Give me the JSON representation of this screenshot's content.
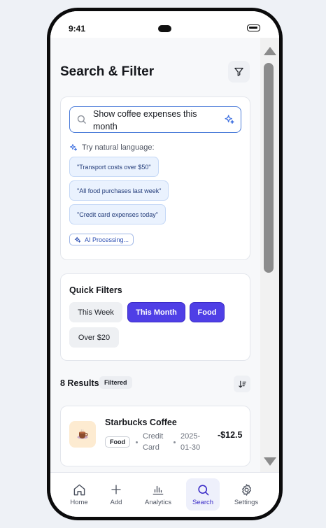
{
  "status_bar": {
    "time": "9:41"
  },
  "header": {
    "title": "Search & Filter"
  },
  "search": {
    "value": "Show coffee expenses this month",
    "hint": "Try natural language:",
    "suggestions": [
      "\"Transport costs over $50\"",
      "\"All food purchases last week\"",
      "\"Credit card expenses today\""
    ],
    "ai_status": "AI Processing..."
  },
  "quick_filters": {
    "title": "Quick Filters",
    "items": [
      {
        "label": "This Week",
        "active": false
      },
      {
        "label": "This Month",
        "active": true
      },
      {
        "label": "Food",
        "active": true
      },
      {
        "label": "Over $20",
        "active": false
      }
    ]
  },
  "results": {
    "count_label": "8 Results",
    "badge": "Filtered",
    "transactions": [
      {
        "name": "Starbucks Coffee",
        "category": "Food",
        "method": "Credit Card",
        "date": "2025-01-30",
        "amount": "-$12.5"
      }
    ]
  },
  "nav": {
    "items": [
      {
        "label": "Home",
        "icon": "home-icon"
      },
      {
        "label": "Add",
        "icon": "plus-icon"
      },
      {
        "label": "Analytics",
        "icon": "bar-chart-icon"
      },
      {
        "label": "Search",
        "icon": "search-icon",
        "active": true
      },
      {
        "label": "Settings",
        "icon": "gear-icon"
      }
    ]
  },
  "colors": {
    "accent": "#4f3fe6",
    "chip_background": "#eaf2fe",
    "search_border": "#4a7bd9",
    "coffee_icon_background": "#fdebd1"
  }
}
